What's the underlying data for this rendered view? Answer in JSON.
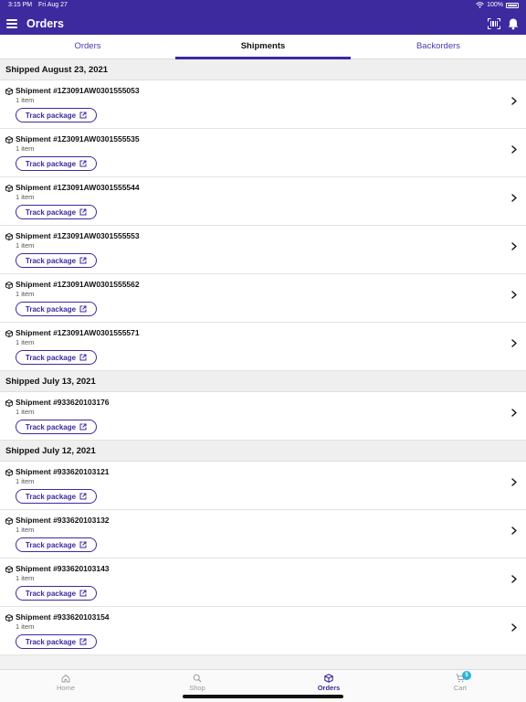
{
  "status_bar": {
    "time": "3:15 PM",
    "date": "Fri Aug 27",
    "battery": "100%"
  },
  "app_bar": {
    "title": "Orders",
    "menu_icon": "menu-icon",
    "scan_icon": "barcode-scan-icon",
    "bell_icon": "bell-icon"
  },
  "tabs": [
    {
      "label": "Orders",
      "active": false
    },
    {
      "label": "Shipments",
      "active": true
    },
    {
      "label": "Backorders",
      "active": false
    }
  ],
  "groups": [
    {
      "header": "Shipped August 23, 2021",
      "shipments": [
        {
          "title": "Shipment #1Z3091AW0301555053",
          "count": "1 item",
          "action": "Track package"
        },
        {
          "title": "Shipment #1Z3091AW0301555535",
          "count": "1 item",
          "action": "Track package"
        },
        {
          "title": "Shipment #1Z3091AW0301555544",
          "count": "1 item",
          "action": "Track package"
        },
        {
          "title": "Shipment #1Z3091AW0301555553",
          "count": "1 item",
          "action": "Track package"
        },
        {
          "title": "Shipment #1Z3091AW0301555562",
          "count": "1 item",
          "action": "Track package"
        },
        {
          "title": "Shipment #1Z3091AW0301555571",
          "count": "1 item",
          "action": "Track package"
        }
      ]
    },
    {
      "header": "Shipped July 13, 2021",
      "shipments": [
        {
          "title": "Shipment #933620103176",
          "count": "1 item",
          "action": "Track package"
        }
      ]
    },
    {
      "header": "Shipped July 12, 2021",
      "shipments": [
        {
          "title": "Shipment #933620103121",
          "count": "1 item",
          "action": "Track package"
        },
        {
          "title": "Shipment #933620103132",
          "count": "1 item",
          "action": "Track package"
        },
        {
          "title": "Shipment #933620103143",
          "count": "1 item",
          "action": "Track package"
        },
        {
          "title": "Shipment #933620103154",
          "count": "1 item",
          "action": "Track package"
        }
      ]
    }
  ],
  "bottom_nav": [
    {
      "label": "Home",
      "icon": "home-icon",
      "active": false
    },
    {
      "label": "Shop",
      "icon": "search-icon",
      "active": false
    },
    {
      "label": "Orders",
      "icon": "package-icon",
      "active": true
    },
    {
      "label": "Cart",
      "icon": "cart-icon",
      "active": false,
      "badge": "5"
    }
  ],
  "colors": {
    "primary": "#3d2a9e",
    "badge": "#2bb3d6"
  }
}
